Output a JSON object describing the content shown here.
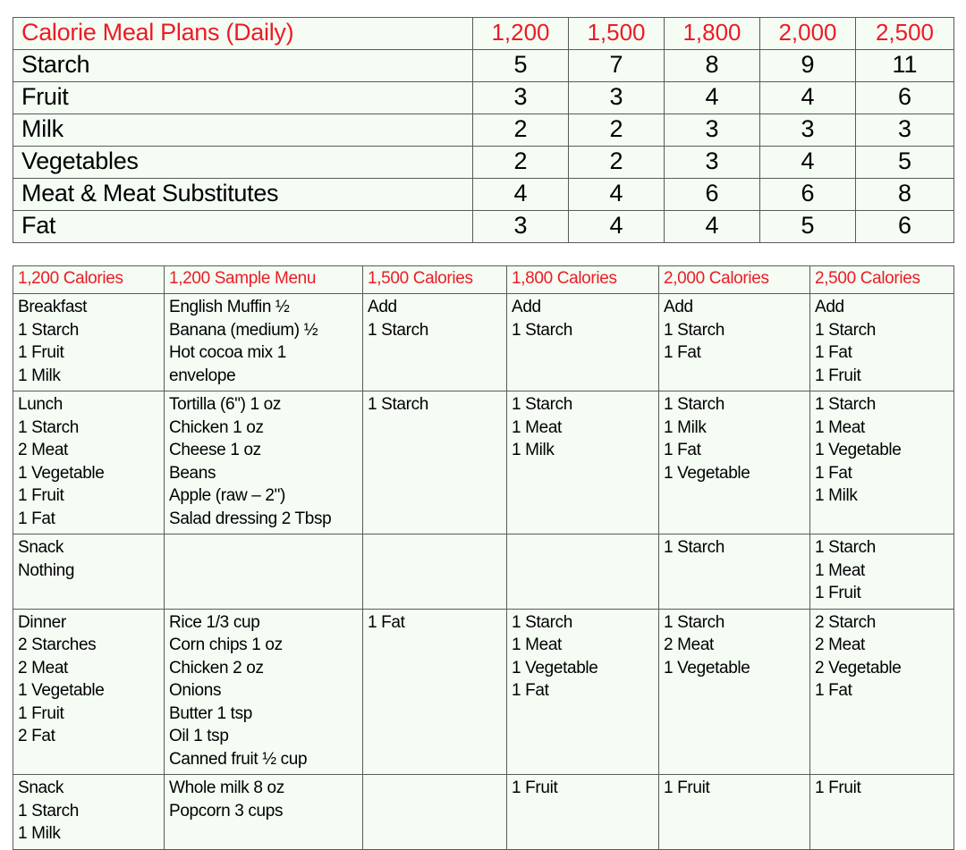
{
  "document": {
    "title": "Calorie Meal Plans (Daily)",
    "accent_color": "#ec1c24",
    "text_color": "#000000",
    "cell_background": "#f4fcf4",
    "border_color": "#5a5a5a"
  },
  "daily_plan_table": {
    "header": {
      "title": "Calorie Meal Plans (Daily)",
      "calorie_levels": [
        "1,200",
        "1,500",
        "1,800",
        "2,000",
        "2,500"
      ]
    },
    "rows": [
      {
        "group": "Starch",
        "values": [
          "5",
          "7",
          "8",
          "9",
          "11"
        ]
      },
      {
        "group": "Fruit",
        "values": [
          "3",
          "3",
          "4",
          "4",
          "6"
        ]
      },
      {
        "group": "Milk",
        "values": [
          "2",
          "2",
          "3",
          "3",
          "3"
        ]
      },
      {
        "group": "Vegetables",
        "values": [
          "2",
          "2",
          "3",
          "4",
          "5"
        ]
      },
      {
        "group": "Meat & Meat  Substitutes",
        "values": [
          "4",
          "4",
          "6",
          "6",
          "8"
        ]
      },
      {
        "group": "Fat",
        "values": [
          "3",
          "4",
          "4",
          "5",
          "6"
        ]
      }
    ]
  },
  "sample_menu_table": {
    "headers": [
      "1,200 Calories",
      "1,200 Sample Menu",
      "1,500 Calories",
      "1,800 Calories",
      "2,000 Calories",
      "2,500 Calories"
    ],
    "rows": [
      {
        "meal": "Breakfast\n1 Starch\n1 Fruit\n1 Milk",
        "sample_menu": "English Muffin ½\nBanana (medium) ½\nHot cocoa mix 1\nenvelope",
        "cal_1500": "Add\n1 Starch",
        "cal_1800": "Add\n1 Starch",
        "cal_2000": "Add\n1 Starch\n1 Fat",
        "cal_2500": "Add\n1 Starch\n1 Fat\n1 Fruit"
      },
      {
        "meal": "Lunch\n1 Starch\n2 Meat\n1 Vegetable\n1 Fruit\n1 Fat",
        "sample_menu": "Tortilla (6\") 1 oz\nChicken 1 oz\nCheese 1 oz\nBeans\nApple (raw – 2\")\nSalad dressing 2 Tbsp",
        "cal_1500": "1 Starch",
        "cal_1800": "1 Starch\n1 Meat\n1 Milk",
        "cal_2000": "1 Starch\n1 Milk\n1 Fat\n1 Vegetable",
        "cal_2500": "1 Starch\n1 Meat\n1 Vegetable\n1 Fat\n1 Milk"
      },
      {
        "meal": "Snack\nNothing",
        "sample_menu": "",
        "cal_1500": "",
        "cal_1800": "",
        "cal_2000": "1 Starch",
        "cal_2500": "1 Starch\n1 Meat\n1 Fruit"
      },
      {
        "meal": "Dinner\n2 Starches\n2 Meat\n1 Vegetable\n1 Fruit\n2 Fat",
        "sample_menu": "Rice 1/3 cup\nCorn chips 1 oz\nChicken 2 oz\nOnions\nButter 1 tsp\nOil 1 tsp\nCanned fruit ½ cup",
        "cal_1500": "1 Fat",
        "cal_1800": "1 Starch\n1 Meat\n1 Vegetable\n1 Fat",
        "cal_2000": "1 Starch\n2 Meat\n1 Vegetable",
        "cal_2500": "2 Starch\n2 Meat\n2 Vegetable\n1 Fat"
      },
      {
        "meal": "Snack\n1 Starch\n1 Milk",
        "sample_menu": "Whole milk 8 oz\nPopcorn 3 cups",
        "cal_1500": "",
        "cal_1800": "1 Fruit",
        "cal_2000": "1 Fruit",
        "cal_2500": "1 Fruit"
      }
    ]
  }
}
